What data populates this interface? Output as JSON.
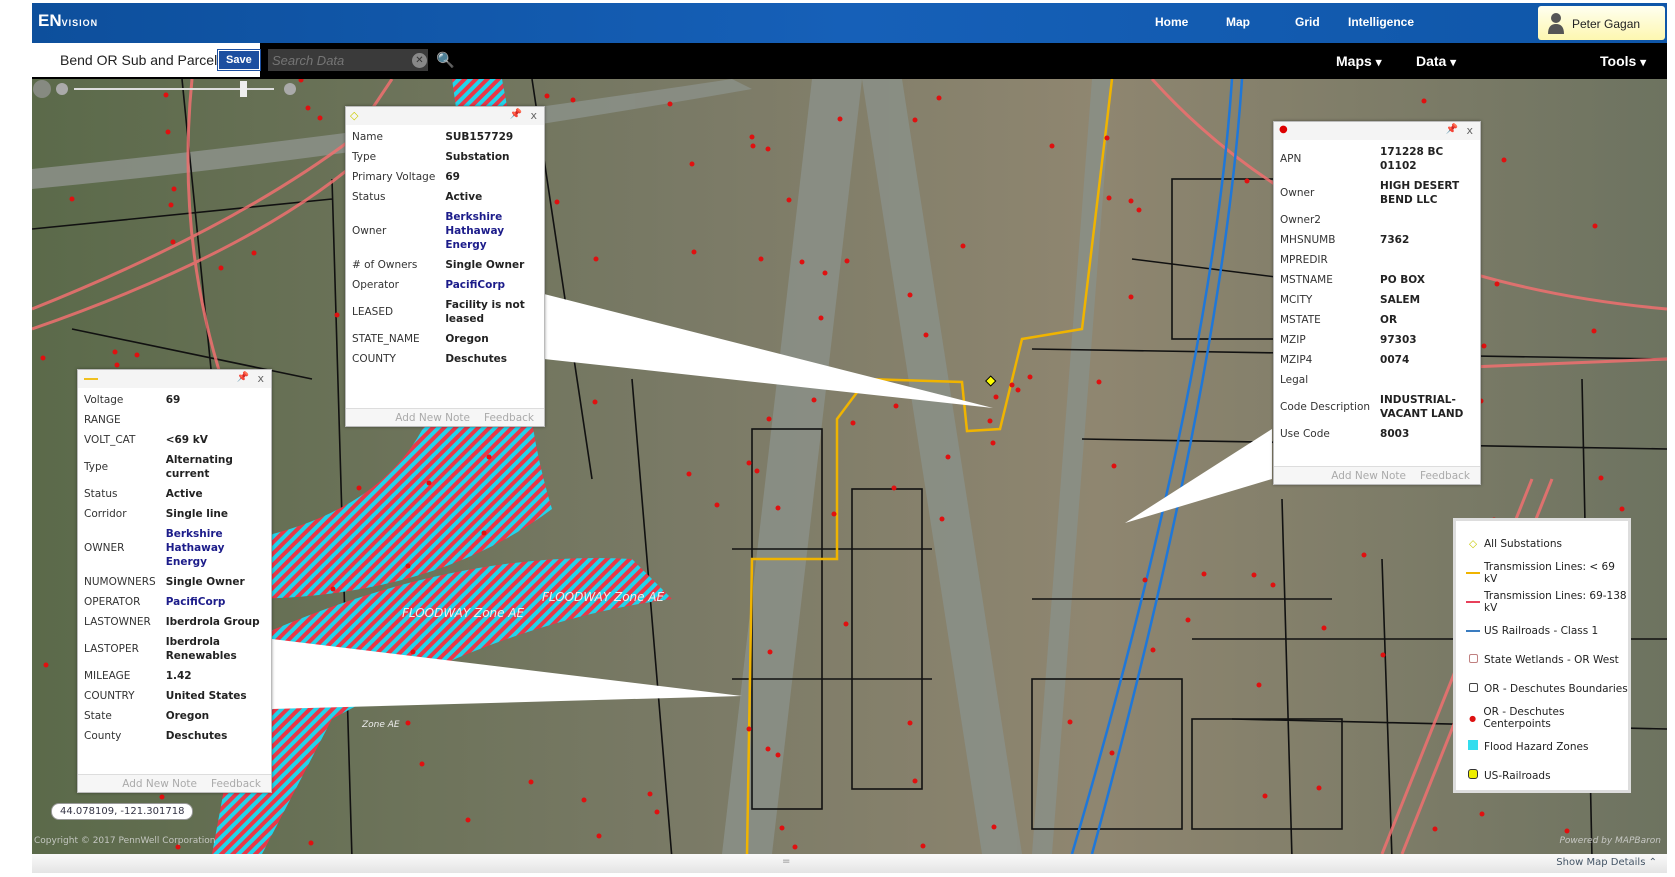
{
  "header": {
    "logo": "ENVISION",
    "logo_main": "EN",
    "logo_sub": "VISION",
    "nav": [
      "Home",
      "Map",
      "Grid",
      "Intelligence"
    ],
    "user": "Peter Gagan"
  },
  "toolbar": {
    "map_name": "Bend OR Sub and Parcel Map",
    "save_label": "Save",
    "search_placeholder": "Search Data",
    "menus": [
      "Maps",
      "Data",
      "Tools"
    ]
  },
  "substation_popup": {
    "icon": "diamond-icon",
    "rows": [
      {
        "k": "Name",
        "v": "SUB157729"
      },
      {
        "k": "Type",
        "v": "Substation"
      },
      {
        "k": "Primary Voltage",
        "v": "69"
      },
      {
        "k": "Status",
        "v": "Active"
      },
      {
        "k": "Owner",
        "v": "Berkshire Hathaway Energy",
        "link": true
      },
      {
        "k": "# of Owners",
        "v": "Single Owner"
      },
      {
        "k": "Operator",
        "v": "PacifiCorp",
        "link": true
      },
      {
        "k": "LEASED",
        "v": "Facility is not leased"
      },
      {
        "k": "STATE_NAME",
        "v": "Oregon"
      },
      {
        "k": "COUNTY",
        "v": "Deschutes"
      }
    ],
    "footer": [
      "Add New Note",
      "Feedback"
    ]
  },
  "parcel_popup": {
    "icon": "dot-icon",
    "rows": [
      {
        "k": "APN",
        "v": "171228 BC 01102"
      },
      {
        "k": "Owner",
        "v": "HIGH DESERT BEND LLC"
      },
      {
        "k": "Owner2",
        "v": ""
      },
      {
        "k": "MHSNUMB",
        "v": "7362"
      },
      {
        "k": "MPREDIR",
        "v": ""
      },
      {
        "k": "MSTNAME",
        "v": "PO BOX"
      },
      {
        "k": "MCITY",
        "v": "SALEM"
      },
      {
        "k": "MSTATE",
        "v": "OR"
      },
      {
        "k": "MZIP",
        "v": "97303"
      },
      {
        "k": "MZIP4",
        "v": "0074"
      },
      {
        "k": "Legal",
        "v": ""
      },
      {
        "k": "Code Description",
        "v": "INDUSTRIAL-VACANT LAND"
      },
      {
        "k": "Use Code",
        "v": "8003"
      }
    ],
    "footer": [
      "Add New Note",
      "Feedback"
    ]
  },
  "line_popup": {
    "icon": "line-icon",
    "rows": [
      {
        "k": "Voltage",
        "v": "69"
      },
      {
        "k": "RANGE",
        "v": ""
      },
      {
        "k": "VOLT_CAT",
        "v": "<69 kV"
      },
      {
        "k": "Type",
        "v": "Alternating current"
      },
      {
        "k": "Status",
        "v": "Active"
      },
      {
        "k": "Corridor",
        "v": "Single line"
      },
      {
        "k": "OWNER",
        "v": "Berkshire Hathaway Energy",
        "link": true
      },
      {
        "k": "NUMOWNERS",
        "v": "Single Owner"
      },
      {
        "k": "OPERATOR",
        "v": "PacifiCorp",
        "link": true
      },
      {
        "k": "LASTOWNER",
        "v": "Iberdrola Group"
      },
      {
        "k": "LASTOPER",
        "v": "Iberdrola Renewables"
      },
      {
        "k": "MILEAGE",
        "v": "1.42"
      },
      {
        "k": "COUNTRY",
        "v": "United States"
      },
      {
        "k": "State",
        "v": "Oregon"
      },
      {
        "k": "County",
        "v": "Deschutes"
      }
    ],
    "footer": [
      "Add New Note",
      "Feedback"
    ]
  },
  "legend": [
    {
      "label": "All Substations",
      "symbol": "diamond",
      "color": "#c8c800"
    },
    {
      "label": "Transmission Lines: < 69 kV",
      "symbol": "line",
      "color": "#f0b400"
    },
    {
      "label": "Transmission Lines: 69-138 kV",
      "symbol": "line",
      "color": "#e8405a"
    },
    {
      "label": "US Railroads - Class 1",
      "symbol": "line",
      "color": "#3a7cc0"
    },
    {
      "label": "State Wetlands - OR West",
      "symbol": "square-outline",
      "color": "#c08080"
    },
    {
      "label": "OR - Deschutes Boundaries",
      "symbol": "square-outline",
      "color": "#444444"
    },
    {
      "label": "OR - Deschutes Centerpoints",
      "symbol": "dot",
      "color": "#dd1111"
    },
    {
      "label": "Flood Hazard Zones",
      "symbol": "square",
      "color": "#33ddee"
    },
    {
      "label": "US-Railroads",
      "symbol": "square-round",
      "color": "#eeee00"
    }
  ],
  "map": {
    "coordinates": "44.078109, -121.301718",
    "flood_labels": [
      "FLOODWAY Zone AE",
      "FLOODWAY Zone AE",
      "Zone AE"
    ],
    "copyright": "Copyright © 2017 PennWell Corporation",
    "powered": "Powered by MAPBaron"
  },
  "footer": {
    "handle": "=",
    "show_details": "Show Map Details"
  }
}
